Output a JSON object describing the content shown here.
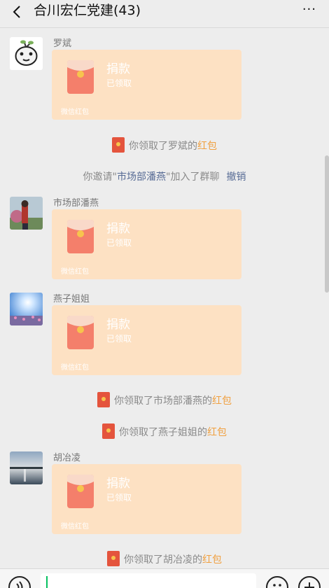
{
  "header": {
    "title": "合川宏仁党建(43)",
    "more": "···"
  },
  "messages": [
    {
      "sender": "罗斌",
      "packet": {
        "title": "捐款",
        "status": "已领取",
        "footer": "微信红包"
      }
    },
    {
      "sender": "市场部潘燕",
      "packet": {
        "title": "捐款",
        "status": "已领取",
        "footer": "微信红包"
      }
    },
    {
      "sender": "燕子姐姐",
      "packet": {
        "title": "捐款",
        "status": "已领取",
        "footer": "微信红包"
      }
    },
    {
      "sender": "胡冶凌",
      "packet": {
        "title": "捐款",
        "status": "已领取",
        "footer": "微信红包"
      }
    }
  ],
  "system": {
    "s1": {
      "prefix": "你领取了罗斌的",
      "link": "红包"
    },
    "invite": {
      "prefix": "你邀请\"",
      "name": "市场部潘燕",
      "suffix": "\"加入了群聊",
      "undo": "撤销"
    },
    "s2": {
      "prefix": "你领取了市场部潘燕的",
      "link": "红包"
    },
    "s3": {
      "prefix": "你领取了燕子姐姐的",
      "link": "红包"
    },
    "s4": {
      "prefix": "你领取了胡冶凌的",
      "link": "红包"
    }
  },
  "colors": {
    "background": "#ededed",
    "packet": "#fde1c3",
    "packet_icon": "#f47f6b",
    "link_orange": "#f0a040",
    "link_blue": "#576b95"
  },
  "icons": [
    "back-arrow-icon",
    "more-icon",
    "red-packet-icon",
    "voice-icon",
    "emoji-icon",
    "plus-icon"
  ]
}
